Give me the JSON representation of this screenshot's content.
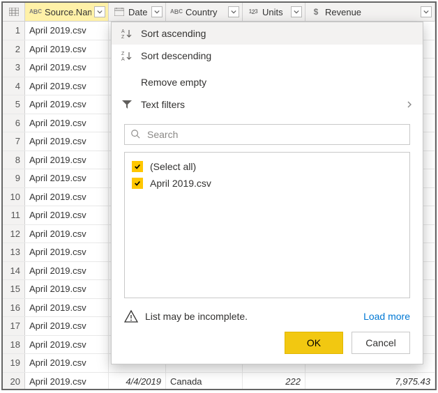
{
  "columns": {
    "source": {
      "label": "Source.Name",
      "type": "abc"
    },
    "date": {
      "label": "Date",
      "type": "date"
    },
    "country": {
      "label": "Country",
      "type": "abc"
    },
    "units": {
      "label": "Units",
      "type": "123"
    },
    "revenue": {
      "label": "Revenue",
      "type": "dollar"
    }
  },
  "rows": [
    {
      "n": "1",
      "source": "April 2019.csv"
    },
    {
      "n": "2",
      "source": "April 2019.csv"
    },
    {
      "n": "3",
      "source": "April 2019.csv"
    },
    {
      "n": "4",
      "source": "April 2019.csv"
    },
    {
      "n": "5",
      "source": "April 2019.csv"
    },
    {
      "n": "6",
      "source": "April 2019.csv"
    },
    {
      "n": "7",
      "source": "April 2019.csv"
    },
    {
      "n": "8",
      "source": "April 2019.csv"
    },
    {
      "n": "9",
      "source": "April 2019.csv"
    },
    {
      "n": "10",
      "source": "April 2019.csv"
    },
    {
      "n": "11",
      "source": "April 2019.csv"
    },
    {
      "n": "12",
      "source": "April 2019.csv"
    },
    {
      "n": "13",
      "source": "April 2019.csv"
    },
    {
      "n": "14",
      "source": "April 2019.csv"
    },
    {
      "n": "15",
      "source": "April 2019.csv"
    },
    {
      "n": "16",
      "source": "April 2019.csv"
    },
    {
      "n": "17",
      "source": "April 2019.csv"
    },
    {
      "n": "18",
      "source": "April 2019.csv"
    },
    {
      "n": "19",
      "source": "April 2019.csv"
    },
    {
      "n": "20",
      "source": "April 2019.csv",
      "date": "4/4/2019",
      "country": "Canada",
      "units": "222",
      "revenue": "7,975.43"
    }
  ],
  "filter": {
    "sort_asc": "Sort ascending",
    "sort_desc": "Sort descending",
    "remove_empty": "Remove empty",
    "text_filters": "Text filters",
    "search_placeholder": "Search",
    "select_all": "(Select all)",
    "items": [
      "April 2019.csv"
    ],
    "incomplete_msg": "List may be incomplete.",
    "load_more": "Load more",
    "ok": "OK",
    "cancel": "Cancel"
  }
}
